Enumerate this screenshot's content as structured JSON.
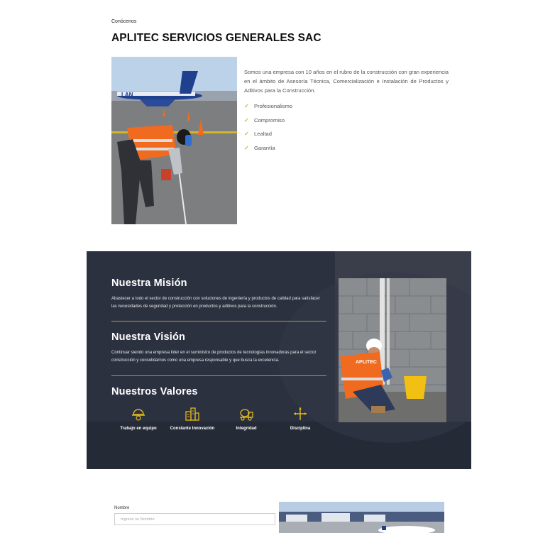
{
  "about": {
    "eyebrow": "Conócenos",
    "title": "APLITEC SERVICIOS GENERALES SAC",
    "description": "Somos una empresa con 10 años en el rubro de la construcción con gran experiencia en el ámbito de Asesoría Técnica, Comercialización e Instalación de Productos y Aditivos para la Construcción.",
    "features": [
      "Profesionalismo",
      "Compromiso",
      "Lealtad",
      "Garantía"
    ],
    "photo_airline_text": "LAN"
  },
  "mission": {
    "mision_title": "Nuestra Misión",
    "mision_text": "Abastecer a todo el sector de construcción con soluciones de ingeniería y productos de calidad para satisfacer las necesidades de seguridad y protección en productos y aditivos para la construcción.",
    "vision_title": "Nuestra Visión",
    "vision_text": "Continuar siendo una empresa líder en el suministro de productos de tecnologías innovadoras para el sector construcción y consolidarnos como una empresa responsable y que busca la excelencia.",
    "valores_title": "Nuestros Valores",
    "valores": [
      {
        "label": "Trabajo en equipo",
        "icon": "helmet-icon"
      },
      {
        "label": "Constante Innovación",
        "icon": "buildings-icon"
      },
      {
        "label": "Integridad",
        "icon": "concrete-mixer-icon"
      },
      {
        "label": "Disciplina",
        "icon": "crossroads-icon"
      }
    ],
    "photo_badge_text": "APLITEC"
  },
  "form": {
    "name_label": "Nombre",
    "name_placeholder": "Ingrese su Nombre"
  },
  "colors": {
    "accent": "#d9b41f",
    "section_bg": "#2c3140",
    "vest": "#f06a1f"
  }
}
